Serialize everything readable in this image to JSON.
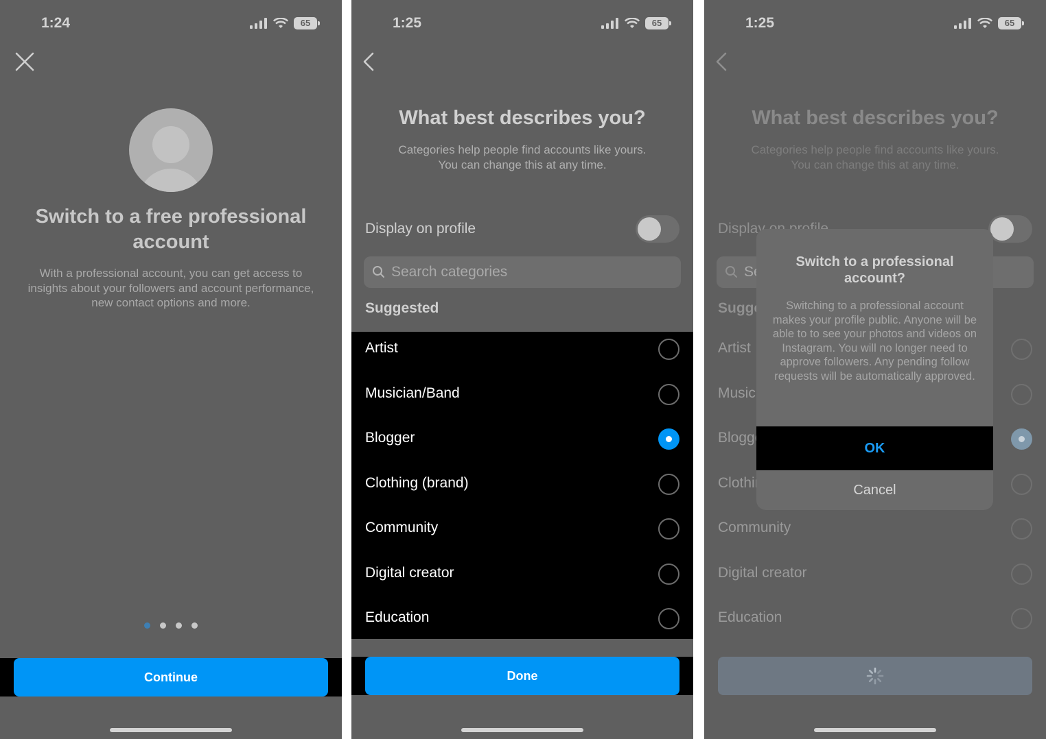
{
  "screens": [
    {
      "time": "1:24",
      "battery": "65",
      "title": "Switch to a free professional account",
      "description": "With a professional account, you can get access to insights about your followers and account performance, new contact options and more.",
      "page_dots": 4,
      "active_dot": 0,
      "continue_label": "Continue"
    },
    {
      "time": "1:25",
      "battery": "65",
      "title": "What best describes you?",
      "description_line1": "Categories help people find accounts like yours.",
      "description_line2": "You can change this at any time.",
      "display_on_profile_label": "Display on profile",
      "display_on_profile_on": false,
      "search_placeholder": "Search categories",
      "suggested_label": "Suggested",
      "categories": [
        {
          "label": "Artist",
          "selected": false
        },
        {
          "label": "Musician/Band",
          "selected": false
        },
        {
          "label": "Blogger",
          "selected": true
        },
        {
          "label": "Clothing (brand)",
          "selected": false
        },
        {
          "label": "Community",
          "selected": false
        },
        {
          "label": "Digital creator",
          "selected": false
        },
        {
          "label": "Education",
          "selected": false
        }
      ],
      "done_label": "Done"
    },
    {
      "time": "1:25",
      "battery": "65",
      "title": "What best describes you?",
      "description_line1": "Categories help people find accounts like yours.",
      "description_line2": "You can change this at any time.",
      "display_on_profile_label": "Display on profile",
      "search_placeholder": "Search categories",
      "suggested_label": "Suggested",
      "categories": [
        {
          "label": "Artist",
          "selected": false
        },
        {
          "label": "Musician/Band",
          "selected": false
        },
        {
          "label": "Blogger",
          "selected": true
        },
        {
          "label": "Clothing (brand)",
          "selected": false
        },
        {
          "label": "Community",
          "selected": false
        },
        {
          "label": "Digital creator",
          "selected": false
        },
        {
          "label": "Education",
          "selected": false
        }
      ],
      "dialog": {
        "title": "Switch to a professional account?",
        "body": "Switching to a professional account makes your profile public. Anyone will be able to to see your photos and videos on Instagram. You will no longer need to approve followers. Any pending follow requests will be automatically approved.",
        "ok_label": "OK",
        "cancel_label": "Cancel"
      }
    }
  ],
  "colors": {
    "accent": "#0095f6",
    "background": "#5f5f5f",
    "list_background": "#000000"
  },
  "icons": [
    "close-icon",
    "back-icon",
    "signal-icon",
    "wifi-icon",
    "battery-icon",
    "search-icon",
    "spinner-icon"
  ]
}
